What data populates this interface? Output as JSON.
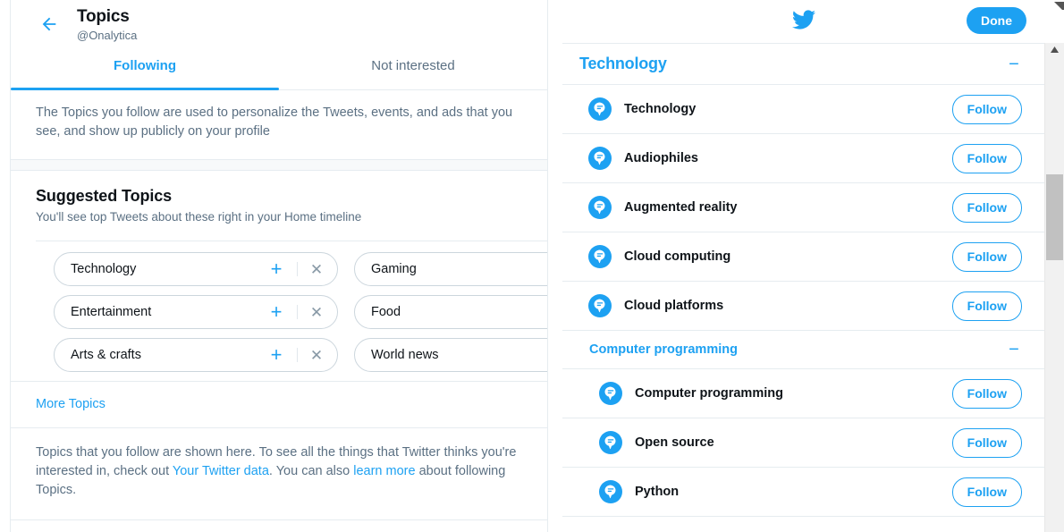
{
  "left_panel": {
    "back_icon": "arrow-left-icon",
    "title": "Topics",
    "handle": "@Onalytica",
    "tabs": [
      {
        "label": "Following",
        "active": true
      },
      {
        "label": "Not interested",
        "active": false
      }
    ],
    "blurb": "The Topics you follow are used to personalize the Tweets, events, and ads that you see, and show up publicly on your profile",
    "suggested": {
      "heading": "Suggested Topics",
      "subheading": "You'll see top Tweets about these right in your Home timeline",
      "chips": [
        {
          "label": "Technology",
          "add_icon": "plus-icon",
          "dismiss_icon": "close-icon"
        },
        {
          "label": "Gaming",
          "add_icon": "plus-icon",
          "dismiss_icon": "close-icon"
        },
        {
          "label": "Entertainment",
          "add_icon": "plus-icon",
          "dismiss_icon": "close-icon"
        },
        {
          "label": "Food",
          "add_icon": "plus-icon",
          "dismiss_icon": "close-icon"
        },
        {
          "label": "Arts & crafts",
          "add_icon": "plus-icon",
          "dismiss_icon": "close-icon"
        },
        {
          "label": "World news",
          "add_icon": "plus-icon",
          "dismiss_icon": "close-icon"
        }
      ]
    },
    "more_topics": "More Topics",
    "footnote": {
      "part1": "Topics that you follow are shown here. To see all the things that Twitter thinks you're interested in, check out ",
      "link1": "Your Twitter data",
      "part2": ". You can also ",
      "link2": "learn more",
      "part3": " about following Topics."
    }
  },
  "right_panel": {
    "logo_icon": "twitter-bird-icon",
    "done_label": "Done",
    "sections": [
      {
        "label": "Technology",
        "level": "primary",
        "collapse_icon": "minus-icon",
        "rows": [
          {
            "icon": "topic-bubble-icon",
            "name": "Technology",
            "action": "Follow",
            "indent": false
          },
          {
            "icon": "topic-bubble-icon",
            "name": "Audiophiles",
            "action": "Follow",
            "indent": false
          },
          {
            "icon": "topic-bubble-icon",
            "name": "Augmented reality",
            "action": "Follow",
            "indent": false
          },
          {
            "icon": "topic-bubble-icon",
            "name": "Cloud computing",
            "action": "Follow",
            "indent": false
          },
          {
            "icon": "topic-bubble-icon",
            "name": "Cloud platforms",
            "action": "Follow",
            "indent": false
          }
        ]
      },
      {
        "label": "Computer programming",
        "level": "secondary",
        "collapse_icon": "minus-icon",
        "rows": [
          {
            "icon": "topic-bubble-icon",
            "name": "Computer programming",
            "action": "Follow",
            "indent": true
          },
          {
            "icon": "topic-bubble-icon",
            "name": "Open source",
            "action": "Follow",
            "indent": true
          },
          {
            "icon": "topic-bubble-icon",
            "name": "Python",
            "action": "Follow",
            "indent": true
          }
        ]
      }
    ],
    "scrollbar": {
      "up_arrow_icon": "caret-up-icon"
    }
  },
  "colors": {
    "accent": "#1da1f2",
    "text": "#0f1419",
    "muted": "#5b7083",
    "border": "#e6ecf0"
  }
}
